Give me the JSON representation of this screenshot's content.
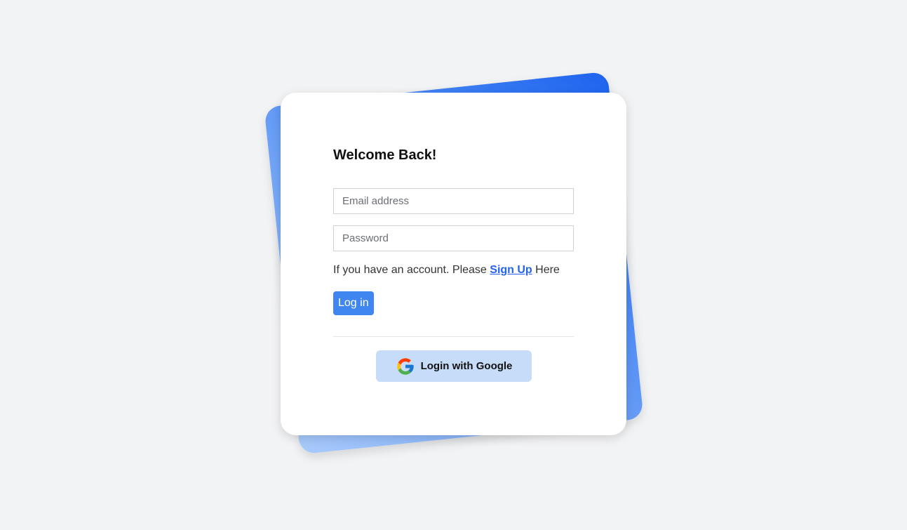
{
  "login": {
    "title": "Welcome Back!",
    "email_placeholder": "Email address",
    "password_placeholder": "Password",
    "signup_prefix": "If you have an account. Please ",
    "signup_link": "Sign Up",
    "signup_suffix": " Here",
    "login_button": "Log in",
    "google_button": "Login with Google"
  },
  "icons": {
    "google": "google-icon"
  },
  "colors": {
    "accent": "#3f86f0",
    "link": "#2563eb",
    "google_button_bg": "#c6dcf9",
    "background": "#f2f3f5"
  }
}
